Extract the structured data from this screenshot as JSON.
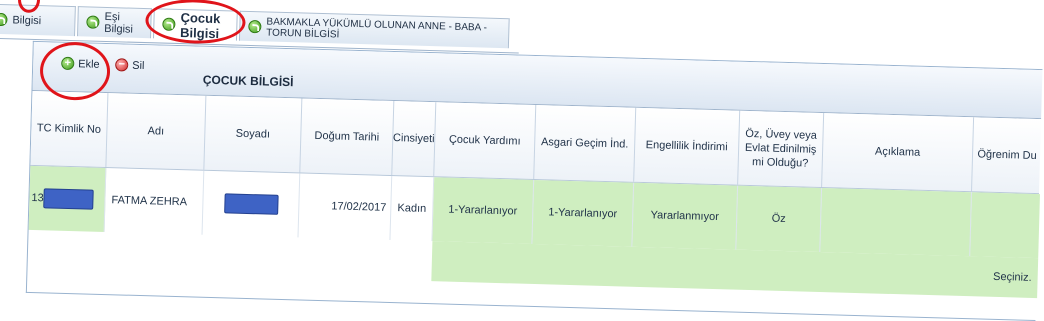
{
  "tabs": [
    {
      "label": "Bilgisi",
      "active": false
    },
    {
      "label": "Eşi Bilgisi",
      "active": false
    },
    {
      "label": "Çocuk Bilgisi",
      "active": true
    },
    {
      "label": "BAKMAKLA YÜKÜMLÜ OLUNAN ANNE - BABA - TORUN BİLGİSİ",
      "active": false
    }
  ],
  "toolbar": {
    "add_label": "Ekle",
    "delete_label": "Sil",
    "title": "ÇOCUK BİLGİSİ"
  },
  "columns": [
    "TC Kimlik No",
    "Adı",
    "Soyadı",
    "Doğum Tarihi",
    "Cinsiyeti",
    "Çocuk Yardımı",
    "Asgari Geçim İnd.",
    "Engellilik İndirimi",
    "Öz, Üvey veya Evlat Edinilmiş mi Olduğu?",
    "Açıklama",
    "Öğrenim Du"
  ],
  "row": {
    "tc_prefix": "13",
    "adi": "FATMA ZEHRA",
    "dogum_tarihi": "17/02/2017",
    "cinsiyeti": "Kadın",
    "cocuk_yardimi": "1-Yararlanıyor",
    "asgari_gecim": "1-Yararlanıyor",
    "engellilik": "Yararlanmıyor",
    "oz_uvey": "Öz",
    "aciklama": "",
    "ogrenim": "Seçiniz."
  },
  "colors": {
    "highlight_circle": "#e0141a",
    "selected_cell": "#cfeec0",
    "redaction": "#3e63c5"
  }
}
